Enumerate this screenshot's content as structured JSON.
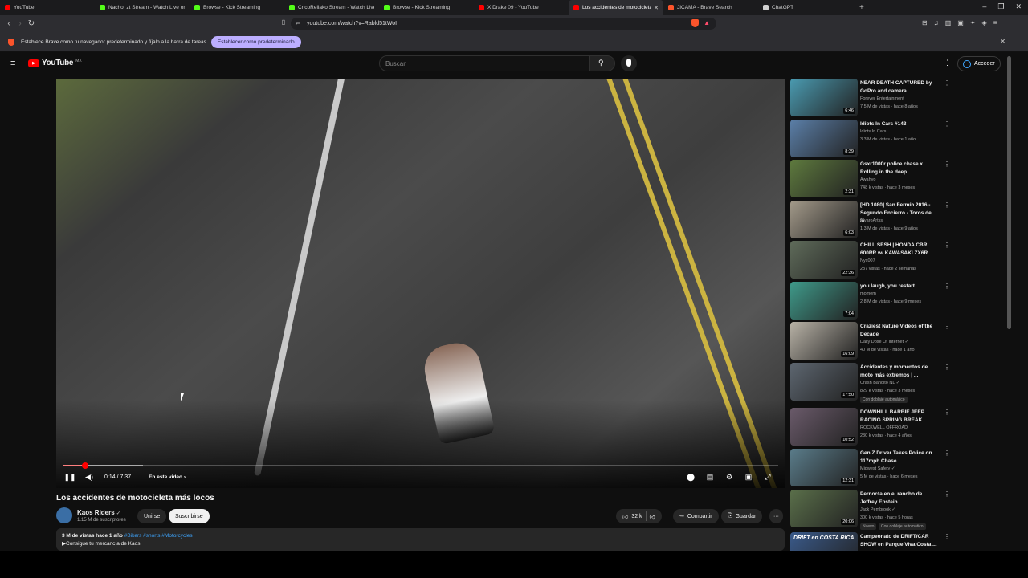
{
  "browser": {
    "tabs": [
      {
        "label": "YouTube",
        "color": "#ff0000"
      },
      {
        "label": "Nacho_zt Stream - Watch Live on Kick",
        "color": "#53fc18"
      },
      {
        "label": "Browse - Kick Streaming",
        "color": "#53fc18"
      },
      {
        "label": "CricoRellako Stream - Watch Live on Kick",
        "color": "#53fc18"
      },
      {
        "label": "Browse - Kick Streaming",
        "color": "#53fc18"
      },
      {
        "label": "X Drake 09 - YouTube",
        "color": "#ff0000"
      },
      {
        "label": "Los accidentes de motocicleta",
        "color": "#ff0000",
        "active": true
      },
      {
        "label": "JICAMA - Brave Search",
        "color": "#fb542b"
      },
      {
        "label": "ChatGPT",
        "color": "#d0d0d0"
      }
    ],
    "new_tab": "+",
    "url": "youtube.com/watch?v=Rabld51tWoI",
    "infobar_text": "Establece Brave como tu navegador predeterminado y fíjalo a la barra de tareas",
    "infobar_button": "Establecer como predeterminado"
  },
  "youtube": {
    "logo": "YouTube",
    "region": "MX",
    "search_placeholder": "Buscar",
    "signin": "Acceder",
    "player": {
      "time": "0:14 / 7:37",
      "progress_fraction": 0.031,
      "chapter": "En este video",
      "chapter_arrow": "›"
    },
    "video_title": "Los accidentes de motocicleta más locos",
    "channel": {
      "name": "Kaos Riders",
      "verified": "✓",
      "subs": "1.15 M de suscriptores"
    },
    "join": "Unirse",
    "subscribe": "Suscribirse",
    "likes": "32 k",
    "share": "Compartir",
    "save": "Guardar",
    "more": "···",
    "description": {
      "views": "3 M de vistas",
      "age": "hace 1 año",
      "hashtags": "#Bikers #shorts #Motorcycles",
      "line2": "▶Consigue tu mercancía de Kaos:"
    },
    "recommendations": [
      {
        "title": "NEAR DEATH CAPTURED by GoPro and camera ...",
        "channel": "Forever Entertainment",
        "meta": "7.5 M de vistas · hace 8 años",
        "duration": "6:46",
        "color": "#4a9ab0"
      },
      {
        "title": "Idiots In Cars #143",
        "channel": "Idiots In Cars",
        "meta": "3.3 M de vistas · hace 1 año",
        "duration": "8:39",
        "color": "#5b7fa8"
      },
      {
        "title": "Gsxr1000r police chase x Rolling in the deep",
        "channel": "Awahyo",
        "meta": "748 k vistas · hace 3 meses",
        "duration": "2:31",
        "color": "#5e7a3e"
      },
      {
        "title": "[HD 1080] San Fermín 2016 - Segundo Encierro - Toros de la...",
        "channel": "AlvaroArtss",
        "meta": "1.3 M de vistas · hace 9 años",
        "duration": "6:03",
        "color": "#a39a8a"
      },
      {
        "title": "CHILL SESH | HONDA CBR 600RR w/ KAWASAKI ZX6R",
        "channel": "Nyx007",
        "meta": "237 vistas · hace 2 semanas",
        "duration": "22:36",
        "color": "#5f6b5a"
      },
      {
        "title": "you laugh, you restart",
        "channel": "momem",
        "meta": "2.8 M de vistas · hace 9 meses",
        "duration": "7:04",
        "color": "#3f9a8a"
      },
      {
        "title": "Craziest Nature Videos of the Decade",
        "channel": "Daily Dose Of Internet",
        "meta": "40 M de vistas · hace 1 año",
        "duration": "16:09",
        "color": "#b8b2a6",
        "verified": true
      },
      {
        "title": "Accidentes y momentos de moto más extremos | ...",
        "channel": "Crash Bandito NL",
        "meta": "829 k vistas · hace 3 meses",
        "duration": "17:50",
        "color": "#5d6670",
        "badge": "Con doblaje automático",
        "verified": true
      },
      {
        "title": "DOWNHILL BARBIE JEEP RACING SPRING BREAK ...",
        "channel": "ROCKWELL OFFROAD",
        "meta": "230 k vistas · hace 4 años",
        "duration": "10:52",
        "color": "#6a5a6a"
      },
      {
        "title": "Gen Z Driver Takes Police on 117mph Chase",
        "channel": "Midwest Safety",
        "meta": "5 M de vistas · hace 6 meses",
        "duration": "12:31",
        "color": "#5a7c8a",
        "verified": true
      },
      {
        "title": "Pernocta en el rancho de Jeffrey Epstein.",
        "channel": "Jack Pembrook",
        "meta": "300 k vistas · hace 5 horas",
        "duration": "20:06",
        "color": "#5a6f4a",
        "badge": "Con doblaje automático",
        "badge_prefix": "Nuevo",
        "verified": true
      },
      {
        "title": "Campeonato de DRIFT/CAR SHOW en Parque Viva Costa ...",
        "channel": "",
        "meta": "",
        "duration": "",
        "color": "#3a5a8a",
        "thumb_text": "DRIFT en COSTA RICA"
      }
    ]
  },
  "colors": {
    "accent": "#ff0000",
    "bg": "#0f0f0f",
    "link": "#3ea6ff"
  }
}
